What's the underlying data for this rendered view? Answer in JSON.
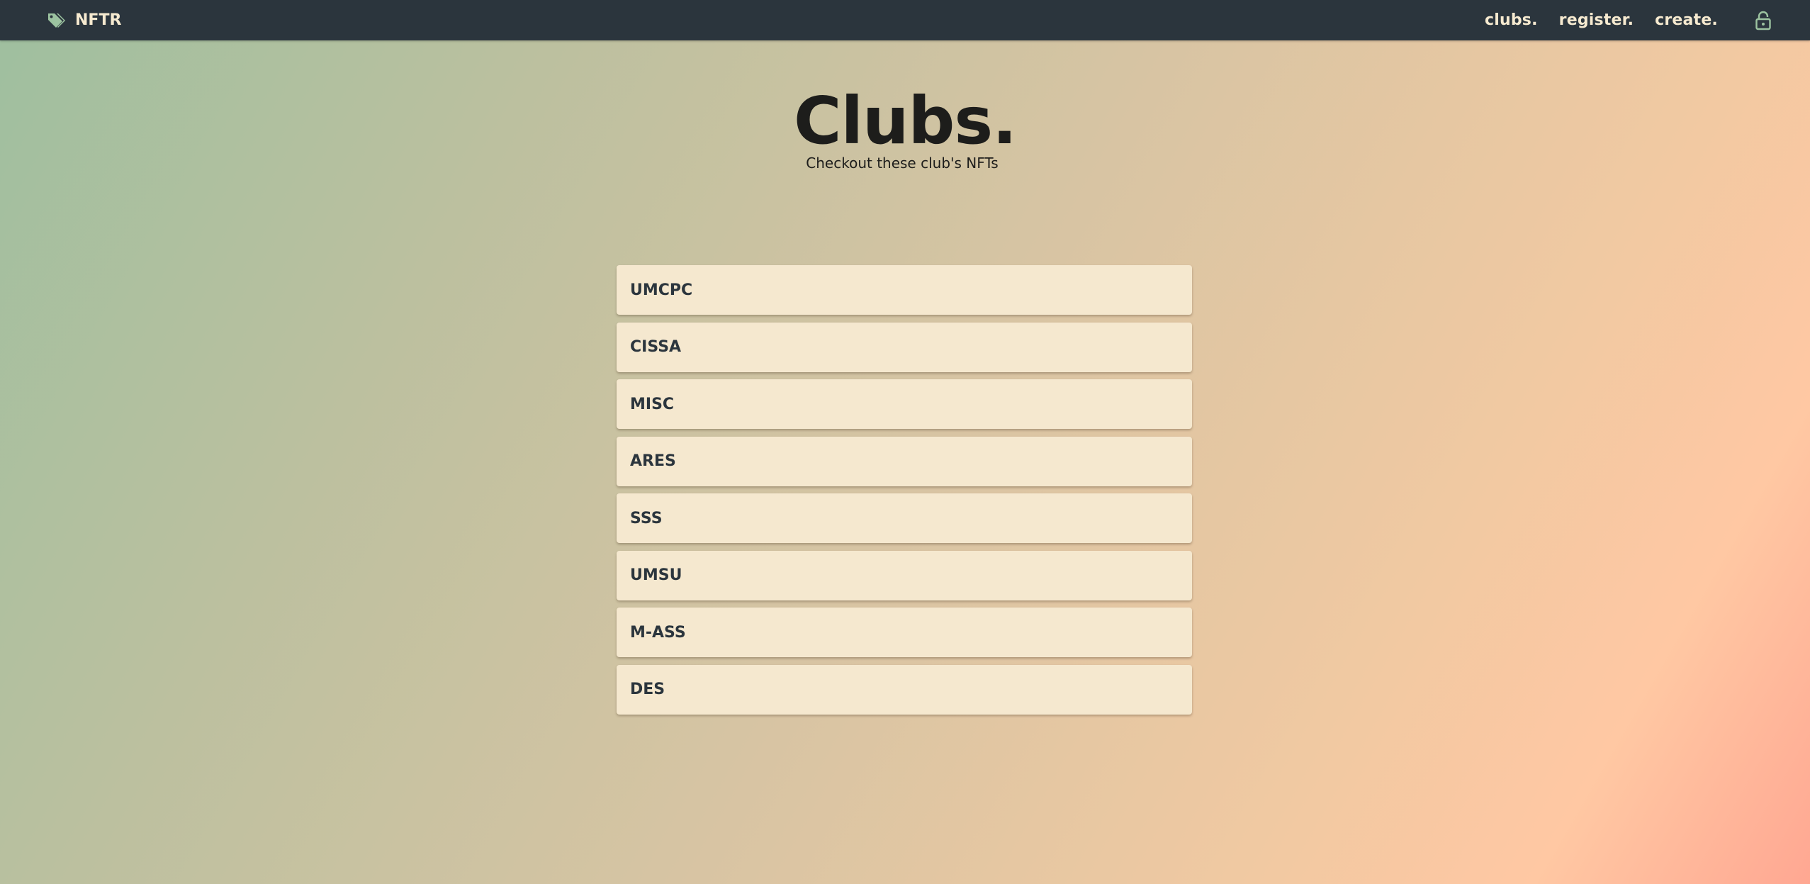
{
  "nav": {
    "brand": "NFTR",
    "links": [
      "clubs.",
      "register.",
      "create."
    ],
    "icons": {
      "brand": "tag-icon",
      "lock": "lock-icon"
    },
    "colors": {
      "bar": "#2b353d",
      "text": "#f6ead0",
      "brand_icon": "#9cc3a0"
    }
  },
  "hero": {
    "title": "Clubs.",
    "subtitle": "Checkout these club's NFTs"
  },
  "clubs": [
    "UMCPC",
    "CISSA",
    "MISC",
    "ARES",
    "SSS",
    "UMSU",
    "M-ASS",
    "DES"
  ],
  "colors": {
    "card": "#f5e8cf",
    "card_text": "#2b353d",
    "gradient_start": "#9ebf9f",
    "gradient_end": "#ffa792"
  }
}
